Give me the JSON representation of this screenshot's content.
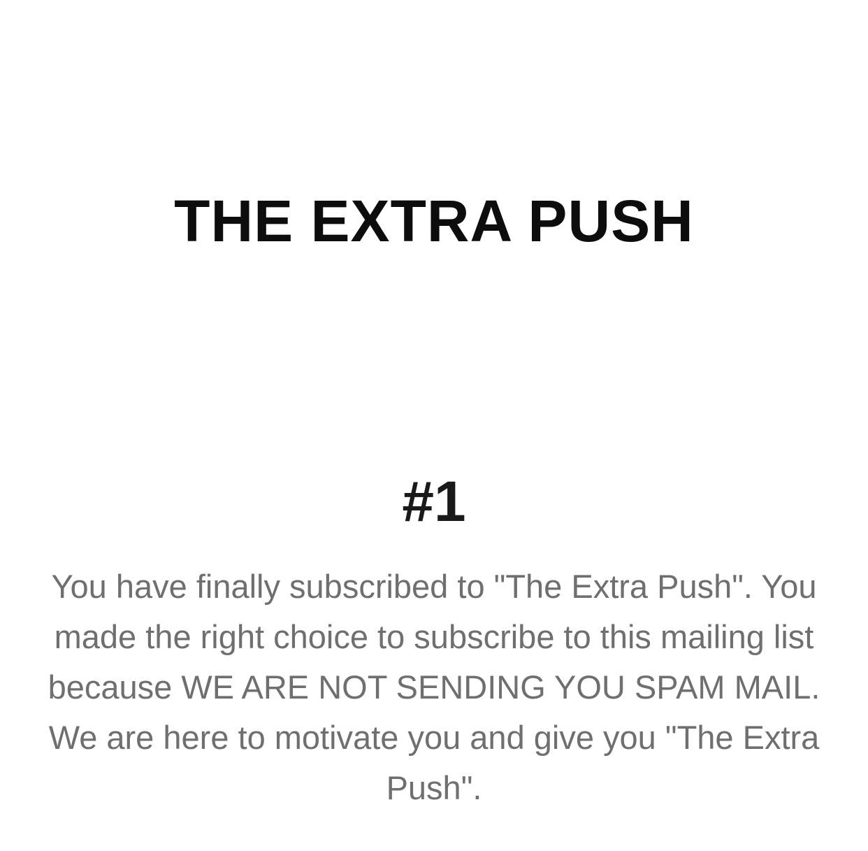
{
  "header": {
    "title": "THE EXTRA PUSH"
  },
  "content": {
    "issue_number": "#1",
    "body": "You have finally subscribed to \"The Extra Push\". You made the right choice to subscribe to this mailing list because WE ARE NOT SENDING YOU SPAM MAIL. We are here to motivate you and give you \"The Extra Push\"."
  },
  "colors": {
    "background": "#ffffff",
    "title": "#0d0d0d",
    "body_text": "#6f6f6f"
  }
}
